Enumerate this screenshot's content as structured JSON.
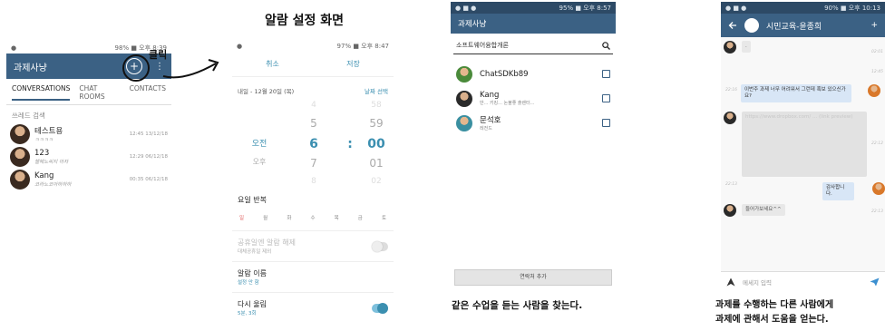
{
  "annotations": {
    "click_label": "클릭",
    "alarm_title": "알람 설정 화면",
    "caption3": "같은 수업을 듣는 사람을 찾는다.",
    "caption4_line1": "과제를 수행하는 다른 사람에게",
    "caption4_line2": "과제에 관해서 도움을 얻는다."
  },
  "screen1": {
    "status_right": "98% ■ 오후 8:39",
    "title": "과제사냥",
    "add_icon": "+",
    "more_icon": "⋮",
    "tabs": [
      "CONVERSATIONS",
      "CHAT ROOMS",
      "CONTACTS"
    ],
    "search_hint": "쓰레드 검색",
    "threads": [
      {
        "name": "테스트용",
        "preview": "ㅋㅋㅋㅋ",
        "time": "12:45 13/12/18"
      },
      {
        "name": "123",
        "preview": "챌헤노씨지 아자",
        "time": "12:29 06/12/18"
      },
      {
        "name": "Kang",
        "preview": "코라노코아하하하",
        "time": "00:35 06/12/18"
      }
    ]
  },
  "screen2": {
    "status_right": "97% ■ 오후 8:47",
    "cancel": "취소",
    "save": "저장",
    "date": "내일 - 12월 20일 (목)",
    "pick_date": "날짜 선택",
    "picker": {
      "rows": [
        {
          "ampm": "",
          "hour": "4",
          "minute": "58"
        },
        {
          "ampm": "",
          "hour": "5",
          "minute": "59"
        },
        {
          "ampm": "오전",
          "hour": "6",
          "minute": "00"
        },
        {
          "ampm": "오후",
          "hour": "7",
          "minute": "01"
        },
        {
          "ampm": "",
          "hour": "8",
          "minute": "02"
        }
      ],
      "separator": ":"
    },
    "repeat_title": "요일 반복",
    "days": [
      "일",
      "월",
      "화",
      "수",
      "목",
      "금",
      "토"
    ],
    "holiday_label": "공휴일엔 알람 해제",
    "holiday_sub": "대체공휴일 제외",
    "alarm_name_label": "알람 이름",
    "alarm_name_sub": "설정 안 함",
    "snooze_label": "다시 울림",
    "snooze_sub": "5분, 3회"
  },
  "screen3": {
    "status_right": "95% ■ 오후 8:57",
    "title": "과제사냥",
    "search_text": "소프트웨어융합개론",
    "contacts": [
      {
        "name": "ChatSDKb89",
        "sub": ""
      },
      {
        "name": "Kang",
        "sub": "반... 키킹... 논불좋 출렌터..."
      },
      {
        "name": "문석호",
        "sub": "레전드"
      }
    ],
    "add_button": "연락처 추가"
  },
  "screen4": {
    "status_right": "90% ■ 오후 10:13",
    "title": "시민교육-윤종희",
    "plus": "+",
    "messages": {
      "m1": ".",
      "t1": "02:01",
      "t2": "12:45",
      "m2": "이번주 과제 너무 어려워서 그런데 혹보 있으신가요?",
      "t3": "22:16",
      "m3": "https://www.dropbox.com/ ... (link preview)",
      "t4": "22:12",
      "t5": "22:13",
      "m4": "감사합니다.",
      "t6": "22:13",
      "m5": "들어가보세요^^",
      "t7": "22:13"
    },
    "input_placeholder": "메세지 입력"
  }
}
